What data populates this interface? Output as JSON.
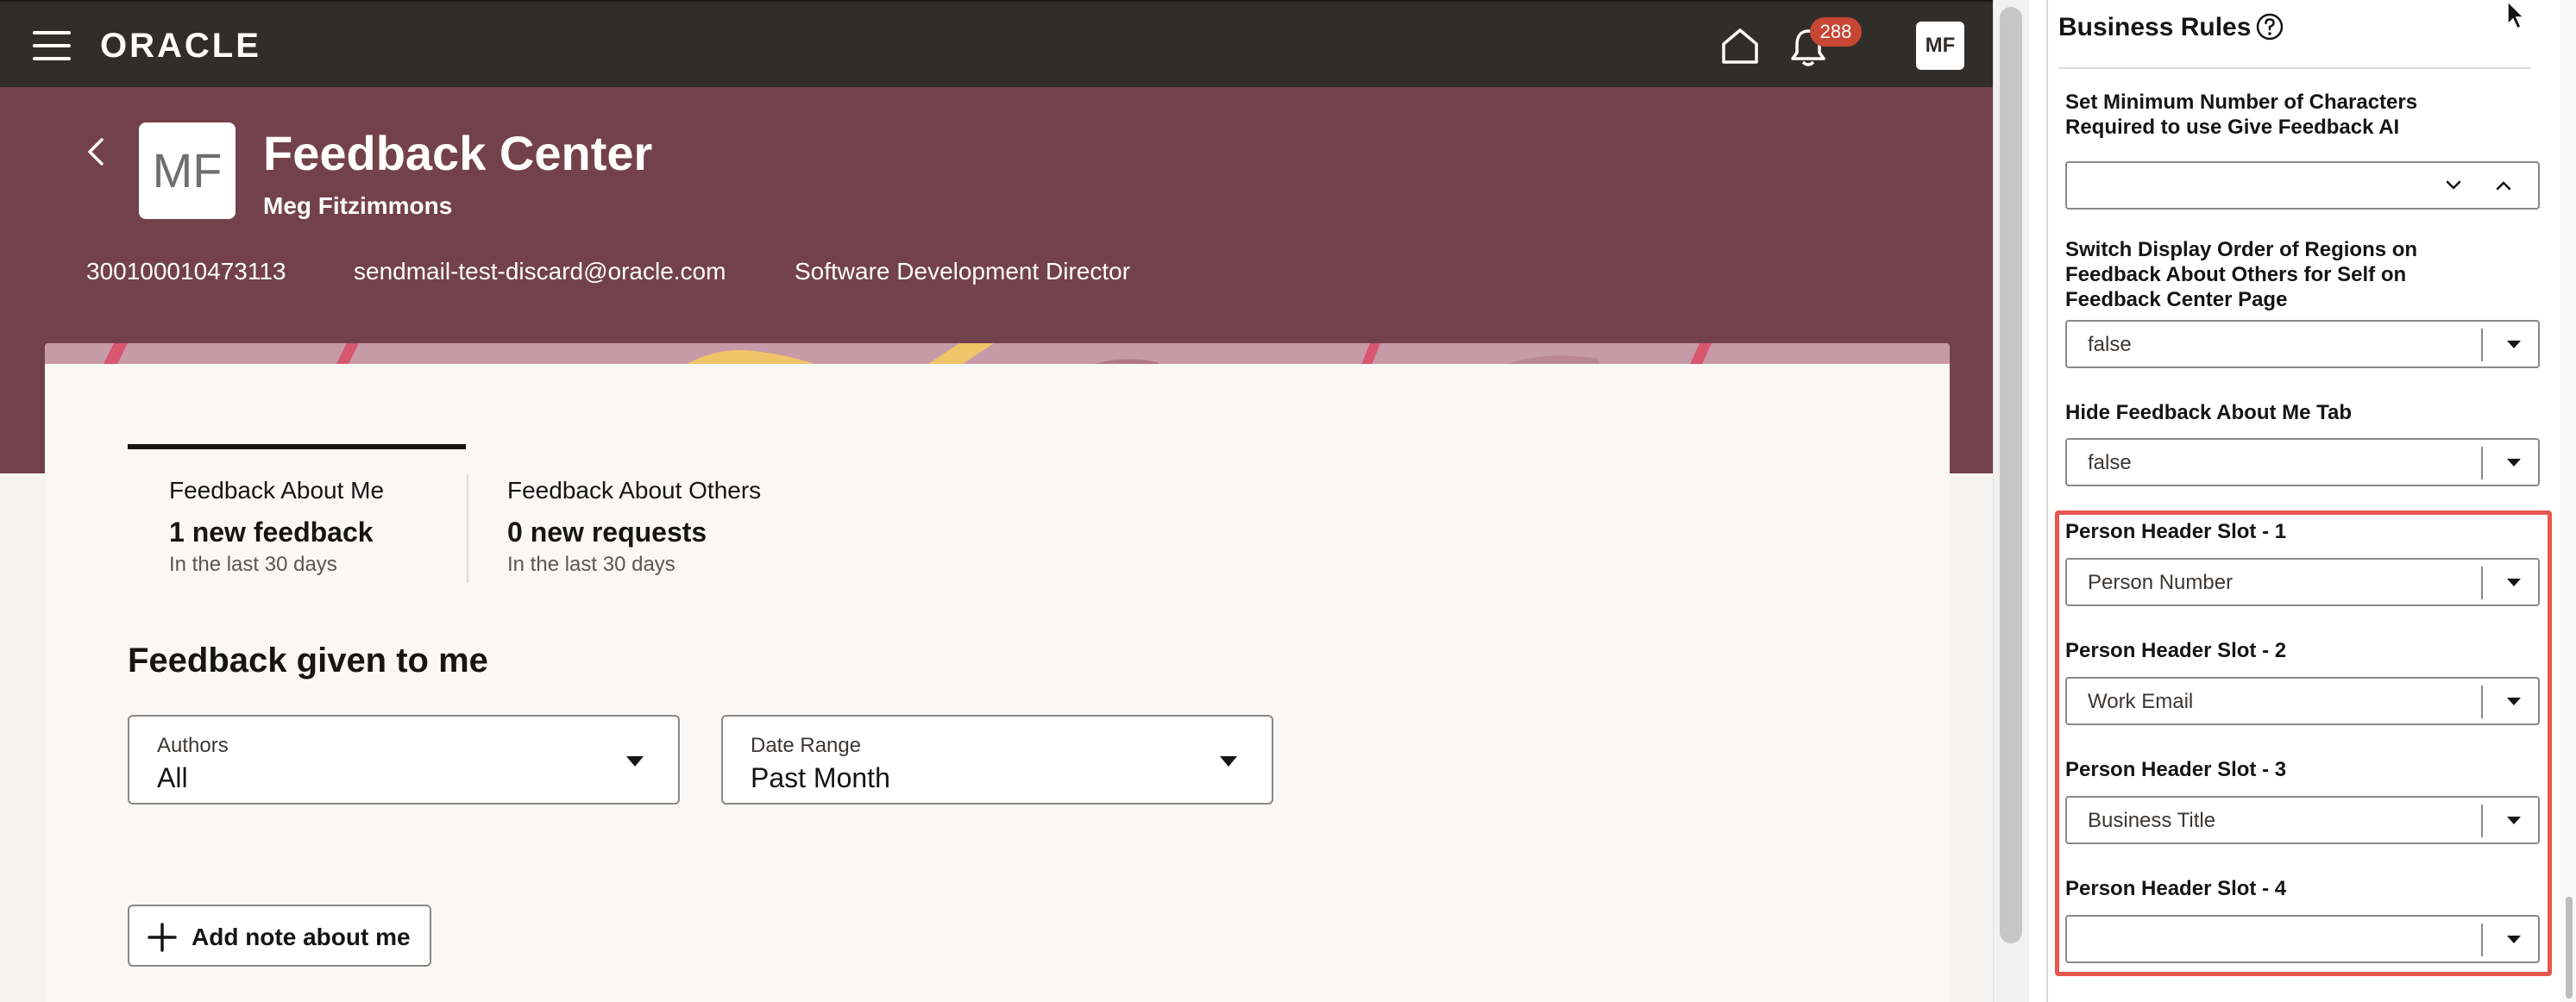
{
  "topbar": {
    "logo": "ORACLE",
    "notification_count": "288",
    "user_initials": "MF"
  },
  "header": {
    "avatar_initials": "MF",
    "title": "Feedback Center",
    "name": "Meg Fitzimmons",
    "person_number": "300100010473113",
    "email": "sendmail-test-discard@oracle.com",
    "business_title": "Software Development Director"
  },
  "tabs": [
    {
      "label": "Feedback About Me",
      "count": "1 new feedback",
      "sub": "In the last 30 days"
    },
    {
      "label": "Feedback About Others",
      "count": "0 new requests",
      "sub": "In the last 30 days"
    }
  ],
  "section": {
    "title": "Feedback given to me"
  },
  "filters": {
    "authors": {
      "label": "Authors",
      "value": "All"
    },
    "date_range": {
      "label": "Date Range",
      "value": "Past Month"
    }
  },
  "add_note": {
    "label": "Add note about me"
  },
  "panel": {
    "title": "Business Rules",
    "rules": [
      {
        "label": "Set Minimum Number of Characters Required to use Give Feedback AI",
        "value": ""
      },
      {
        "label": "Switch Display Order of Regions on Feedback About Others for Self on Feedback Center Page",
        "value": "false"
      },
      {
        "label": "Hide Feedback About Me Tab",
        "value": "false"
      },
      {
        "label": "Person Header Slot - 1",
        "value": "Person Number"
      },
      {
        "label": "Person Header Slot - 2",
        "value": "Work Email"
      },
      {
        "label": "Person Header Slot - 3",
        "value": "Business Title"
      },
      {
        "label": "Person Header Slot - 4",
        "value": ""
      }
    ]
  },
  "colors": {
    "topbar": "#312d2a",
    "hero": "#73414c",
    "badge": "#c74634",
    "highlight": "#e5574f"
  }
}
